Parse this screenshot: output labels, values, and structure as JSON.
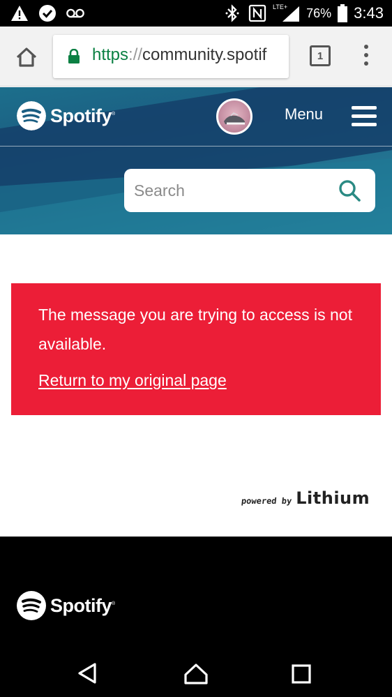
{
  "status_bar": {
    "time": "3:43",
    "battery_percent": "76%",
    "network": "LTE+",
    "icons": [
      "warning-icon",
      "check-circle-icon",
      "voicemail-icon",
      "bluetooth-icon",
      "nfc-icon",
      "signal-icon",
      "battery-icon"
    ]
  },
  "browser": {
    "url_scheme": "https",
    "url_separator": "://",
    "url_host": "community.spotif",
    "tab_count": "1",
    "icons": [
      "home-icon",
      "lock-icon",
      "more-vert-icon"
    ]
  },
  "header": {
    "brand": "Spotify",
    "trademark": "®",
    "menu_label": "Menu",
    "search_placeholder": "Search"
  },
  "error": {
    "message": "The message you are trying to access is not available.",
    "link_text": "Return to my original page"
  },
  "powered": {
    "prefix": "powered by",
    "brand": "Lithium"
  },
  "footer": {
    "brand": "Spotify",
    "trademark": "®"
  },
  "colors": {
    "error_red": "#ec1e37",
    "url_green": "#0b8043",
    "header_blue": "#1b5e82",
    "search_icon_teal": "#2a8a83"
  }
}
